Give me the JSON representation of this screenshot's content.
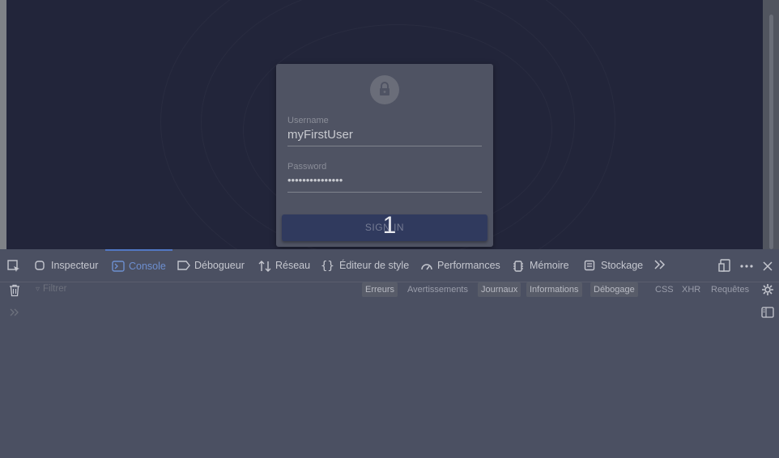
{
  "login": {
    "username_label": "Username",
    "username_value": "myFirstUser",
    "password_label": "Password",
    "password_value": "•••••••••••••••",
    "signin_label": "SIGN IN",
    "overlay_counter": "1"
  },
  "devtools": {
    "tabs": {
      "inspector": "Inspecteur",
      "console": "Console",
      "debugger": "Débogueur",
      "network": "Réseau",
      "style_editor": "Éditeur de style",
      "performance": "Performances",
      "memory": "Mémoire",
      "storage": "Stockage"
    },
    "console_filter_placeholder": "Filtrer",
    "levels": {
      "errors": "Erreurs",
      "warnings": "Avertissements",
      "logs": "Journaux",
      "info": "Informations",
      "debug": "Débogage",
      "css": "CSS",
      "xhr": "XHR",
      "requests": "Requêtes"
    }
  },
  "colors": {
    "active_tab": "#6d8fd0",
    "viewport_bg": "#22253a",
    "signin_button": "#303a5e"
  }
}
